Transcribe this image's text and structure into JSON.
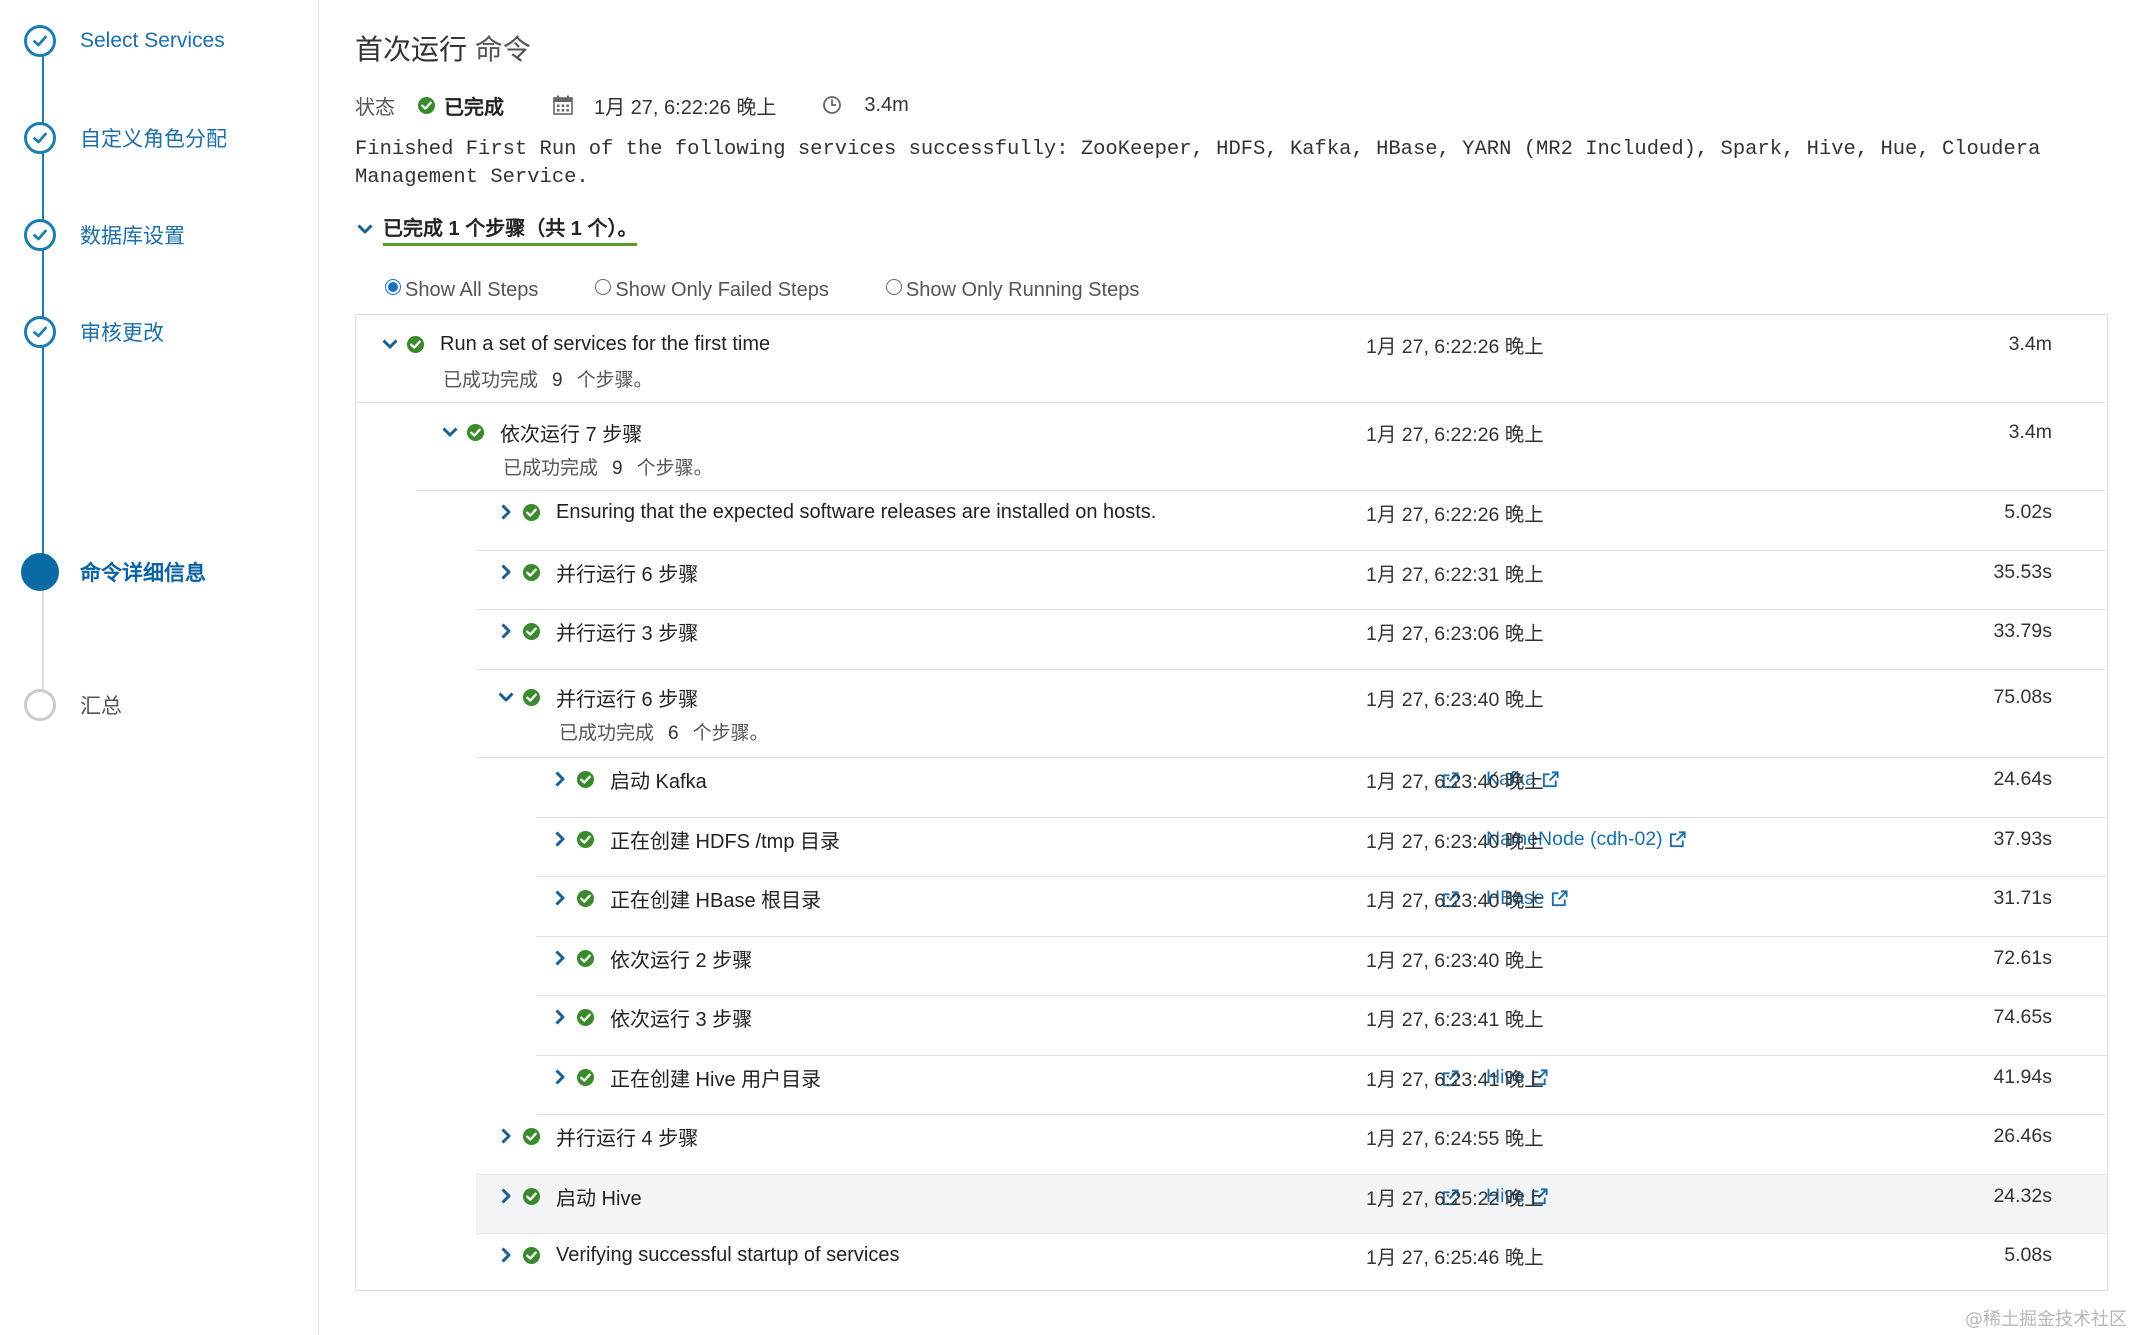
{
  "wizard": {
    "steps": [
      {
        "label": "Select Services",
        "state": "done"
      },
      {
        "label": "自定义角色分配",
        "state": "done"
      },
      {
        "label": "数据库设置",
        "state": "done"
      },
      {
        "label": "审核更改",
        "state": "done"
      },
      {
        "label": "命令详细信息",
        "state": "active"
      },
      {
        "label": "汇总",
        "state": "pending"
      }
    ]
  },
  "header": {
    "title_main": "首次运行",
    "title_sub": "命令",
    "status_label": "状态",
    "status_value": "已完成",
    "time": "1月 27, 6:22:26 晚上",
    "duration": "3.4m",
    "message": "Finished First Run of the following services successfully: ZooKeeper, HDFS, Kafka, HBase, YARN (MR2 Included), Spark, Hive, Hue, Cloudera Management Service.",
    "summary": "已完成 1 个步骤（共 1 个）。"
  },
  "filters": {
    "all": "Show All Steps",
    "failed": "Show Only Failed Steps",
    "running": "Show Only Running Steps",
    "selected": "all"
  },
  "steps": {
    "root": {
      "label": "Run a set of services for the first time",
      "sub_prefix": "已成功完成",
      "sub_count": "9",
      "sub_suffix": "个步骤。",
      "time": "1月 27, 6:22:26 晚上",
      "duration": "3.4m"
    },
    "seq": {
      "label": "依次运行 7 步骤",
      "sub_prefix": "已成功完成",
      "sub_count": "9",
      "sub_suffix": "个步骤。",
      "time": "1月 27, 6:22:26 晚上",
      "duration": "3.4m"
    },
    "s1": {
      "label": "Ensuring that the expected software releases are installed on hosts.",
      "time": "1月 27, 6:22:26 晚上",
      "duration": "5.02s"
    },
    "s2": {
      "label": "并行运行 6 步骤",
      "time": "1月 27, 6:22:31 晚上",
      "duration": "35.53s"
    },
    "s3": {
      "label": "并行运行 3 步骤",
      "time": "1月 27, 6:23:06 晚上",
      "duration": "33.79s"
    },
    "s4": {
      "label": "并行运行 6 步骤",
      "sub_prefix": "已成功完成",
      "sub_count": "6",
      "sub_suffix": "个步骤。",
      "time": "1月 27, 6:23:40 晚上",
      "duration": "75.08s"
    },
    "c1": {
      "label": "启动 Kafka",
      "link": "Kafka",
      "time": "1月 27, 6:23:40 晚上",
      "duration": "24.64s"
    },
    "c2": {
      "label": "正在创建 HDFS /tmp 目录",
      "link": "NameNode (cdh-02)",
      "time": "1月 27, 6:23:40 晚上",
      "duration": "37.93s"
    },
    "c3": {
      "label": "正在创建 HBase 根目录",
      "link": "HBase",
      "time": "1月 27, 6:23:40 晚上",
      "duration": "31.71s"
    },
    "c4": {
      "label": "依次运行 2 步骤",
      "time": "1月 27, 6:23:40 晚上",
      "duration": "72.61s"
    },
    "c5": {
      "label": "依次运行 3 步骤",
      "time": "1月 27, 6:23:41 晚上",
      "duration": "74.65s"
    },
    "c6": {
      "label": "正在创建 Hive 用户目录",
      "link": "Hive",
      "time": "1月 27, 6:23:41 晚上",
      "duration": "41.94s"
    },
    "s5": {
      "label": "并行运行 4 步骤",
      "time": "1月 27, 6:24:55 晚上",
      "duration": "26.46s"
    },
    "s6": {
      "label": "启动 Hive",
      "link": "Hive",
      "time": "1月 27, 6:25:22 晚上",
      "duration": "24.32s"
    },
    "s7": {
      "label": "Verifying successful startup of services",
      "time": "1月 27, 6:25:46 晚上",
      "duration": "5.08s"
    }
  },
  "icons": {
    "status_ok": "check-circle-icon",
    "expand": "chevron-right-icon",
    "collapse": "chevron-down-icon",
    "external": "external-link-icon",
    "calendar": "calendar-icon",
    "clock": "clock-icon"
  },
  "colors": {
    "accent": "#1c7db3",
    "success": "#3c8a2e",
    "underline": "#5a9e1d",
    "link": "#1c6fa8"
  },
  "watermark": "@稀土掘金技术社区"
}
